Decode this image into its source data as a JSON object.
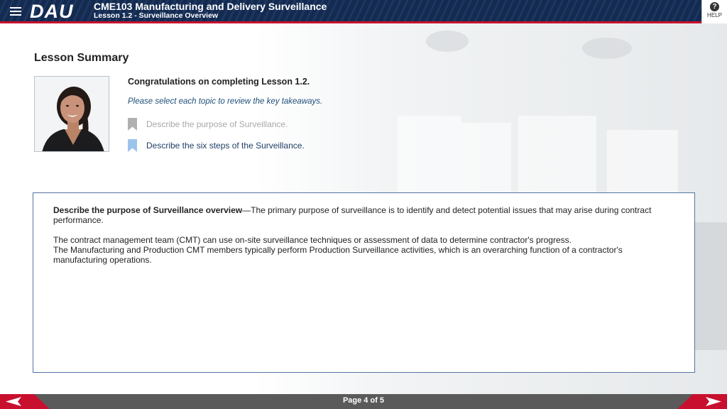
{
  "header": {
    "logo": "DAU",
    "course_title": "CME103 Manufacturing and Delivery Surveillance",
    "lesson_title": "Lesson 1.2 - Surveillance Overview",
    "help_label": "HELP",
    "help_icon": "?"
  },
  "summary": {
    "title": "Lesson Summary",
    "congrats": "Congratulations on completing Lesson 1.2.",
    "instruction": "Please select each topic to review the key takeaways.",
    "topics": [
      {
        "label": "Describe the purpose of Surveillance.",
        "state": "visited",
        "icon": "bookmark-icon"
      },
      {
        "label": "Describe the six steps of the Surveillance.",
        "state": "unvisited",
        "icon": "bookmark-icon"
      }
    ]
  },
  "content": {
    "heading": "Describe the purpose of Surveillance overview",
    "intro": "—The primary purpose of surveillance is to identify and detect potential issues that may arise during contract performance.",
    "para2_line1": "The contract management team (CMT) can use on-site surveillance techniques or assessment of data to determine contractor's progress.",
    "para2_line2": "The Manufacturing and Production CMT members typically perform Production Surveillance activities, which is an overarching function of a contractor's manufacturing operations."
  },
  "footer": {
    "page_indicator": "Page 4 of 5"
  },
  "colors": {
    "header_bg": "#142a4f",
    "header_accent": "#c8102e",
    "visited_bookmark": "#b0b0b0",
    "unvisited_bookmark": "#9cc3ec",
    "box_border": "#5572a3",
    "footer_bg": "#5a5a5a"
  }
}
